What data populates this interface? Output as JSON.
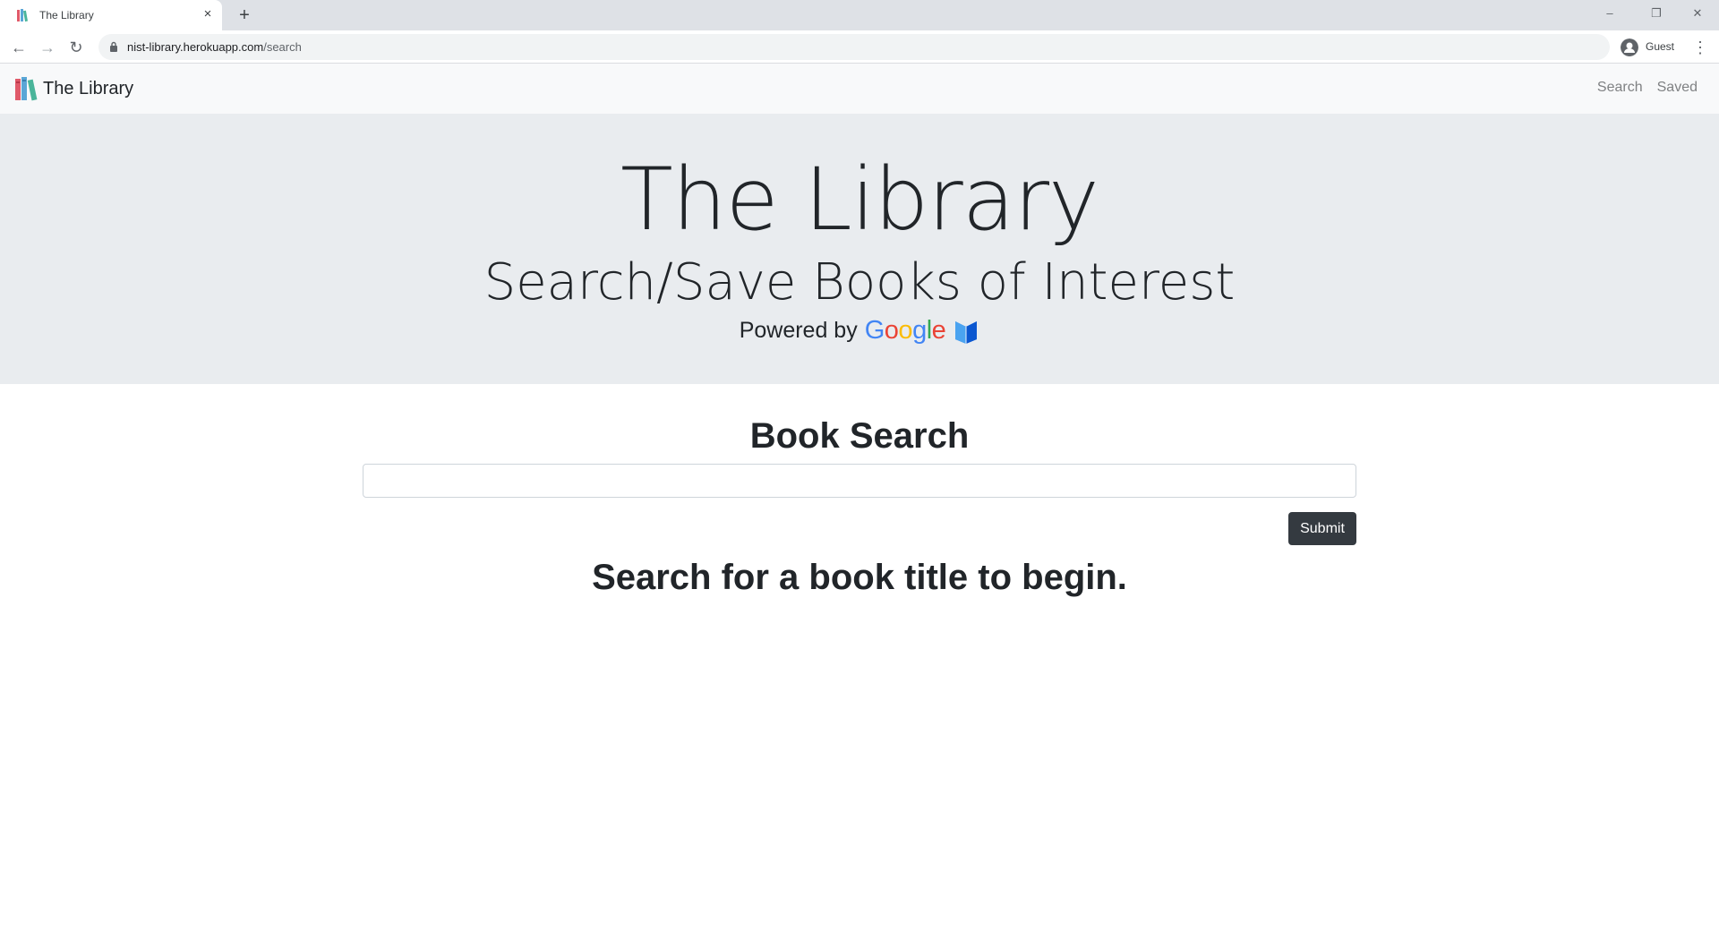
{
  "browser": {
    "tab": {
      "title": "The Library",
      "close_glyph": "×"
    },
    "new_tab_glyph": "+",
    "window_controls": {
      "minimize": "–",
      "restore": "❐",
      "close": "✕"
    },
    "nav": {
      "back": "←",
      "forward": "→",
      "reload": "↻",
      "menu": "⋮"
    },
    "url": {
      "host": "nist-library.herokuapp.com",
      "path": "/search"
    },
    "profile": {
      "label": "Guest"
    }
  },
  "navbar": {
    "brand": "The Library",
    "links": [
      "Search",
      "Saved"
    ]
  },
  "hero": {
    "title": "The Library",
    "subtitle": "Search/Save Books of Interest",
    "powered_by": "Powered by",
    "google_letters": [
      "G",
      "o",
      "o",
      "g",
      "l",
      "e"
    ]
  },
  "search": {
    "heading": "Book Search",
    "input_value": "",
    "submit_label": "Submit",
    "empty_message": "Search for a book title to begin."
  },
  "colors": {
    "navbar_bg": "#f8f9fa",
    "hero_bg": "#e9ecef",
    "button_bg": "#343a40",
    "google_blue": "#4285f4",
    "google_red": "#ea4335",
    "google_yellow": "#fbbc05",
    "google_green": "#34a853"
  },
  "icons": {
    "tab_favicon": "books-icon",
    "brand_logo": "books-logo-icon",
    "powered_icon": "google-books-icon",
    "omnibox": "lock-icon",
    "profile": "avatar-icon"
  }
}
